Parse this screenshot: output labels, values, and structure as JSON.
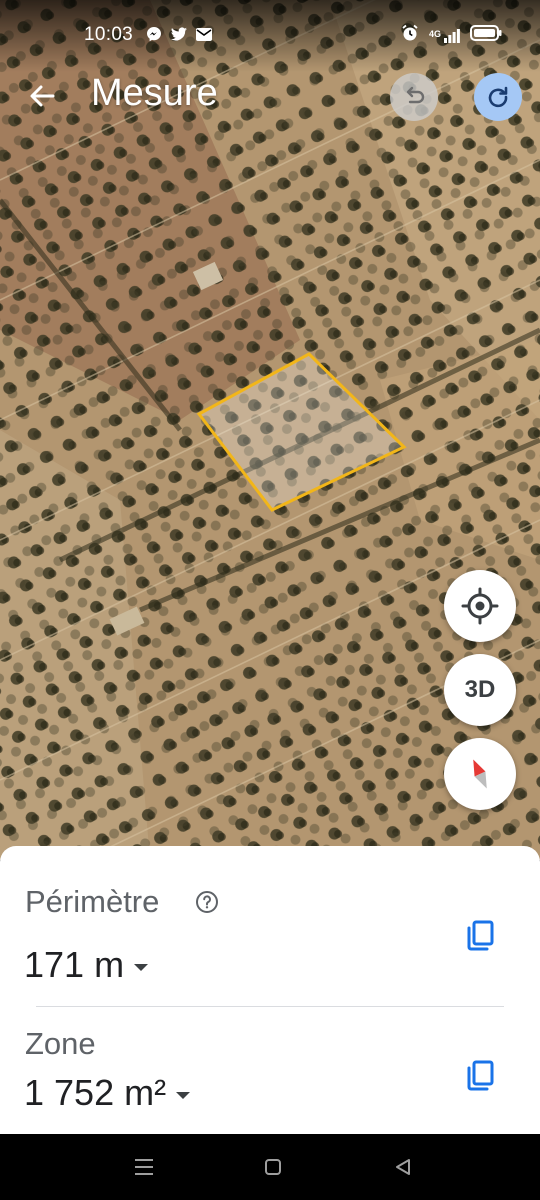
{
  "status_bar": {
    "time": "10:03",
    "notification_icons": [
      "messenger-icon",
      "twitter-icon",
      "mail-icon"
    ],
    "system_icons": [
      "alarm-icon",
      "signal-4g-icon",
      "battery-icon"
    ],
    "network_label": "4G"
  },
  "app_bar": {
    "title": "Mesure",
    "back_icon": "arrow-back-icon",
    "undo_icon": "undo-icon",
    "redo_icon": "redo-icon"
  },
  "map_controls": {
    "location_icon": "my-location-icon",
    "three_d_label": "3D",
    "compass_icon": "compass-icon"
  },
  "measurement": {
    "perimeter_label": "Périmètre",
    "perimeter_value": "171 m",
    "area_label": "Zone",
    "area_value": "1 752 m²",
    "help_icon": "help-icon",
    "copy_icon": "copy-icon"
  },
  "colors": {
    "polygon_outline": "#f2b619",
    "redo_button": "#a5c8f5",
    "copy_icon": "#1a73e8"
  },
  "nav_bar": {
    "icons": [
      "menu-icon",
      "home-icon",
      "back-icon"
    ]
  }
}
